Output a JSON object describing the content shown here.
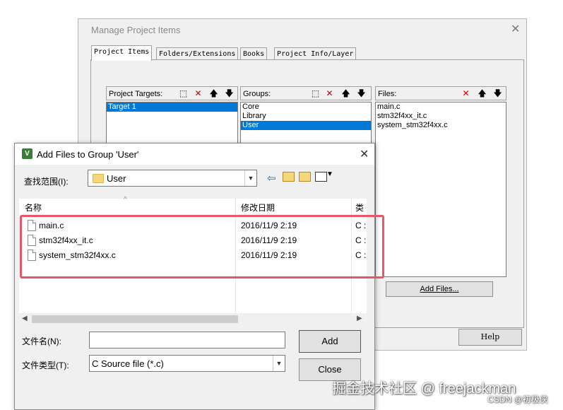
{
  "manage": {
    "title": "Manage Project Items",
    "close": "✕",
    "tabs": [
      "Project Items",
      "Folders/Extensions",
      "Books",
      "Project Info/Layer"
    ],
    "targets_label": "Project Targets:",
    "targets": [
      "Target 1"
    ],
    "groups_label": "Groups:",
    "groups": [
      "Core",
      "Library",
      "User"
    ],
    "files_label": "Files:",
    "files": [
      "main.c",
      "stm32f4xx_it.c",
      "system_stm32f4xx.c"
    ],
    "add_files_label": "Add Files...",
    "help_label": "Help"
  },
  "addfiles": {
    "title": "Add Files to Group 'User'",
    "close": "✕",
    "lookin_label": "查找范围(I):",
    "lookin_value": "User",
    "columns": {
      "name": "名称",
      "date": "修改日期",
      "type": "类"
    },
    "rows": [
      {
        "name": "main.c",
        "date": "2016/11/9 2:19",
        "type": "C :"
      },
      {
        "name": "stm32f4xx_it.c",
        "date": "2016/11/9 2:19",
        "type": "C :"
      },
      {
        "name": "system_stm32f4xx.c",
        "date": "2016/11/9 2:19",
        "type": "C :"
      }
    ],
    "filename_label": "文件名(N):",
    "filename_value": "",
    "filetype_label": "文件类型(T):",
    "filetype_value": "C Source file (*.c)",
    "add_label": "Add",
    "close_label": "Close"
  },
  "watermark": {
    "main": "掘金技术社区 @ freejackman",
    "sub": "CSDN @初极侠"
  },
  "colors": {
    "selection": "#0078d7",
    "highlight": "#e8566a"
  }
}
